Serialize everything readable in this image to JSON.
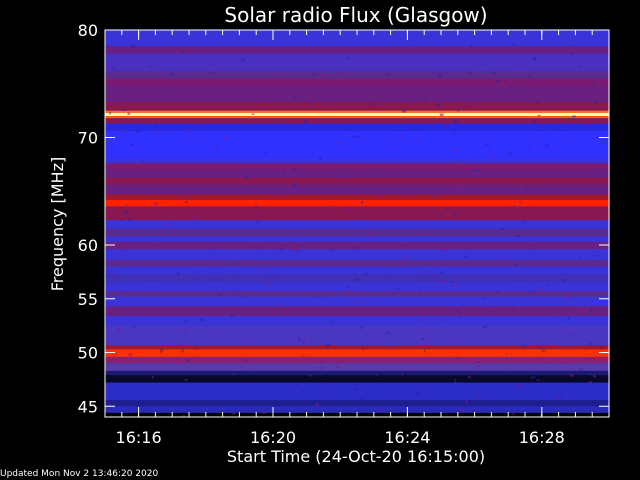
{
  "chart_data": {
    "type": "heatmap",
    "title": "Solar radio Flux (Glasgow)",
    "xlabel": "Start Time (24-Oct-20 16:15:00)",
    "ylabel": "Frequency [MHz]",
    "x_unit": "minutes after 16:15:00",
    "xlim": [
      0,
      15
    ],
    "ylim": [
      80,
      44
    ],
    "x_ticks": [
      {
        "value": 1,
        "label": "16:16"
      },
      {
        "value": 5,
        "label": "16:20"
      },
      {
        "value": 9,
        "label": "16:24"
      },
      {
        "value": 13,
        "label": "16:28"
      }
    ],
    "y_ticks": [
      {
        "value": 45,
        "label": "45"
      },
      {
        "value": 50,
        "label": "50"
      },
      {
        "value": 55,
        "label": "55"
      },
      {
        "value": 60,
        "label": "60"
      },
      {
        "value": 70,
        "label": "70"
      },
      {
        "value": 80,
        "label": "80"
      }
    ],
    "colormap": [
      "#000000",
      "#1e1ea0",
      "#3232ff",
      "#7a1a8a",
      "#b41414",
      "#ff2a00",
      "#ff9a00",
      "#ffff80"
    ],
    "background_color": "#3a34d8",
    "bands": [
      {
        "from": 44.0,
        "to": 44.4,
        "color": "#000000"
      },
      {
        "from": 44.4,
        "to": 45.0,
        "color": "#2a2ab8"
      },
      {
        "from": 45.0,
        "to": 45.6,
        "color": "#1e1e90"
      },
      {
        "from": 45.6,
        "to": 47.2,
        "color": "#2c2cc8"
      },
      {
        "from": 47.2,
        "to": 47.9,
        "color": "#08082a"
      },
      {
        "from": 47.9,
        "to": 48.3,
        "color": "#1a1a70"
      },
      {
        "from": 48.3,
        "to": 49.0,
        "color": "#5a3aa8"
      },
      {
        "from": 49.0,
        "to": 49.6,
        "color": "#8a2070"
      },
      {
        "from": 49.6,
        "to": 50.3,
        "color": "#ff3000"
      },
      {
        "from": 50.3,
        "to": 50.7,
        "color": "#a01830"
      },
      {
        "from": 50.7,
        "to": 52.5,
        "color": "#4a36c0"
      },
      {
        "from": 53.4,
        "to": 54.3,
        "color": "#6a2080"
      },
      {
        "from": 55.2,
        "to": 55.7,
        "color": "#5a2a90"
      },
      {
        "from": 56.5,
        "to": 57.3,
        "color": "#4030b8"
      },
      {
        "from": 58.0,
        "to": 58.6,
        "color": "#5a2a90"
      },
      {
        "from": 59.6,
        "to": 60.3,
        "color": "#6a2080"
      },
      {
        "from": 60.8,
        "to": 61.5,
        "color": "#5a2a90"
      },
      {
        "from": 62.3,
        "to": 63.6,
        "color": "#8a1850"
      },
      {
        "from": 63.6,
        "to": 64.2,
        "color": "#ff2200"
      },
      {
        "from": 64.2,
        "to": 64.7,
        "color": "#a01830"
      },
      {
        "from": 64.7,
        "to": 65.6,
        "color": "#6a2080"
      },
      {
        "from": 65.6,
        "to": 66.3,
        "color": "#8a1850"
      },
      {
        "from": 66.3,
        "to": 67.0,
        "color": "#6a2080"
      },
      {
        "from": 67.0,
        "to": 67.6,
        "color": "#7a1a70"
      },
      {
        "from": 68.0,
        "to": 70.6,
        "color": "#3030ff"
      },
      {
        "from": 70.6,
        "to": 71.3,
        "color": "#2828e0"
      },
      {
        "from": 71.3,
        "to": 71.8,
        "color": "#8a1850"
      },
      {
        "from": 71.8,
        "to": 72.0,
        "color": "#ff5a00"
      },
      {
        "from": 72.0,
        "to": 72.3,
        "color": "#ffffb0"
      },
      {
        "from": 72.3,
        "to": 72.5,
        "color": "#ff7000"
      },
      {
        "from": 72.5,
        "to": 73.3,
        "color": "#8a1850"
      },
      {
        "from": 73.3,
        "to": 74.8,
        "color": "#6a2080"
      },
      {
        "from": 74.8,
        "to": 75.5,
        "color": "#7a1a70"
      },
      {
        "from": 75.5,
        "to": 76.2,
        "color": "#5a2a90"
      },
      {
        "from": 76.2,
        "to": 77.8,
        "color": "#4a30c0"
      },
      {
        "from": 77.8,
        "to": 78.5,
        "color": "#6a2080"
      },
      {
        "from": 78.5,
        "to": 80.0,
        "color": "#3a34d8"
      }
    ]
  },
  "footer": {
    "updated": "Updated Mon Nov  2 13:46:20 2020"
  }
}
